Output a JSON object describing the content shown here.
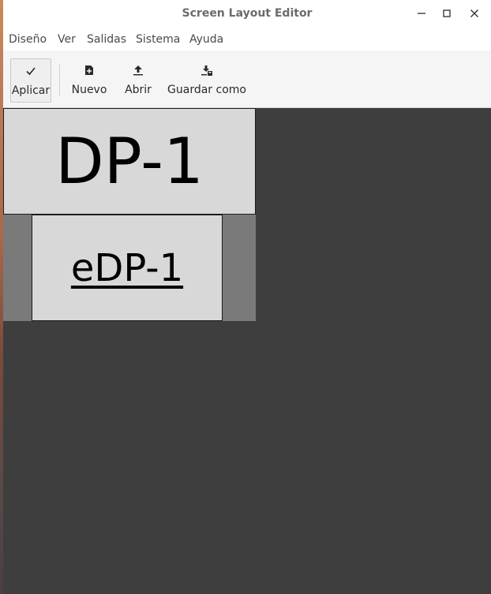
{
  "window": {
    "title": "Screen Layout Editor"
  },
  "menu": [
    "Diseño",
    "Ver",
    "Salidas",
    "Sistema",
    "Ayuda"
  ],
  "toolbar": {
    "apply": "Aplicar",
    "new": "Nuevo",
    "open": "Abrir",
    "save_as": "Guardar como"
  },
  "monitors": {
    "primary": "DP-1",
    "secondary": "eDP-1"
  },
  "icons": {
    "apply": "check-icon",
    "new": "new-file-icon",
    "open": "upload-icon",
    "save_as": "download-icon",
    "minimize": "minimize-icon",
    "maximize": "maximize-icon",
    "close": "close-icon"
  }
}
